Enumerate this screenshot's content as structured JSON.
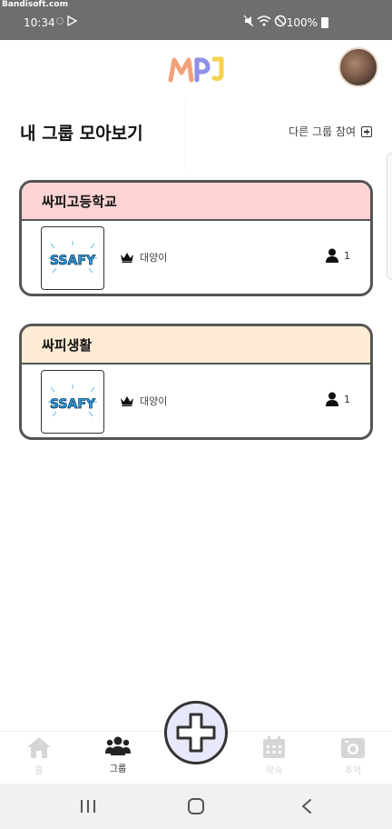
{
  "watermark": "Bandisoft.com",
  "status": {
    "time": "10:34",
    "battery": "100%"
  },
  "header": {
    "logo_text": "MPJ"
  },
  "page": {
    "title": "내 그룹 모아보기",
    "join_label": "다른 그룹 참여"
  },
  "groups": [
    {
      "name": "싸피고등학교",
      "leader": "대양이",
      "member_count": "1",
      "header_color": "#fdd3d3",
      "logo_text": "SSAFY"
    },
    {
      "name": "싸피생활",
      "leader": "대양이",
      "member_count": "1",
      "header_color": "#fdebd3",
      "logo_text": "SSAFY"
    }
  ],
  "nav": {
    "home": "홈",
    "group": "그룹",
    "promise": "약속",
    "memory": "추억"
  },
  "colors": {
    "accent_fab": "#e8e8fb",
    "border": "#555555"
  }
}
